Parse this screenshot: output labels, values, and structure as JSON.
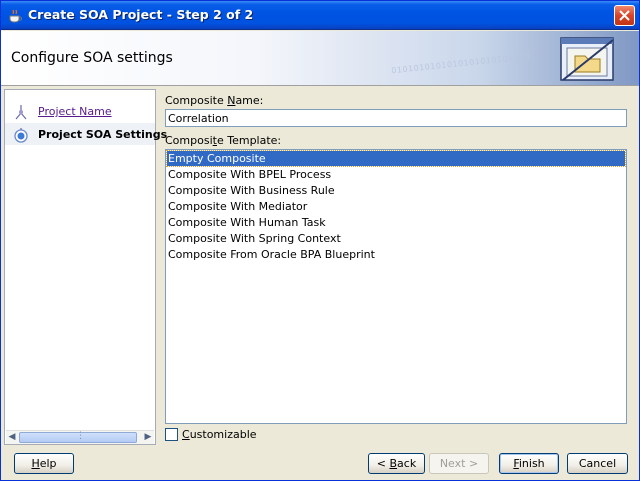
{
  "window": {
    "title": "Create SOA Project - Step 2 of 2"
  },
  "header": {
    "title": "Configure SOA settings",
    "binary_text": "0101010101010101010101010"
  },
  "nav": {
    "steps": [
      {
        "label": "Project Name",
        "state": "visited"
      },
      {
        "label": "Project SOA Settings",
        "state": "current"
      }
    ]
  },
  "form": {
    "composite_name": {
      "label_pre": "Composite ",
      "label_mnemonic": "N",
      "label_post": "ame:",
      "value": "Correlation"
    },
    "composite_template": {
      "label_pre": "Composi",
      "label_mnemonic": "t",
      "label_post": "e Template:",
      "items": [
        "Empty Composite",
        "Composite With BPEL Process",
        "Composite With Business Rule",
        "Composite With Mediator",
        "Composite With Human Task",
        "Composite With Spring Context",
        "Composite From Oracle BPA Blueprint"
      ],
      "selected_index": 0
    },
    "customizable": {
      "label_mnemonic": "C",
      "label_post": "ustomizable",
      "checked": false
    }
  },
  "buttons": {
    "help": {
      "mnemonic": "H",
      "post": "elp"
    },
    "back": {
      "pre": "< ",
      "mnemonic": "B",
      "post": "ack"
    },
    "next": {
      "pre": "Next >"
    },
    "finish": {
      "mnemonic": "F",
      "post": "inish"
    },
    "cancel": {
      "pre": "Cancel"
    }
  },
  "colors": {
    "titlebar": "#0054e3",
    "selection": "#316ac5",
    "visited_link": "#551a8b"
  }
}
